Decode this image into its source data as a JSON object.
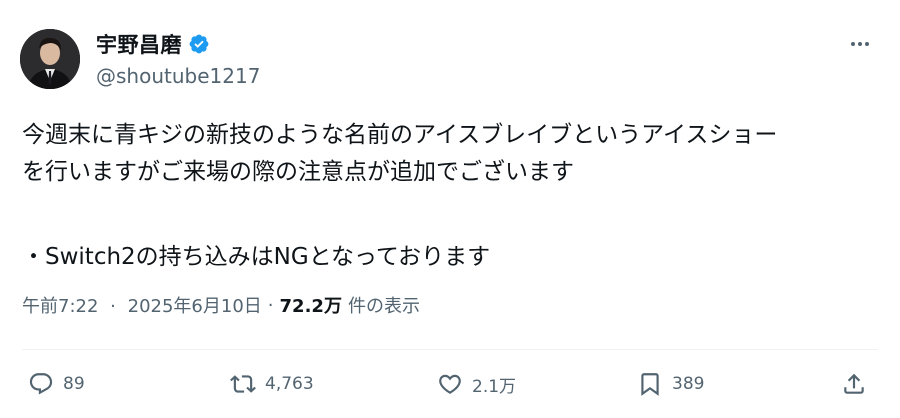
{
  "author": {
    "display_name": "宇野昌磨",
    "handle": "@shoutube1217",
    "verified": true,
    "avatar_icon": "profile-avatar-icon"
  },
  "tweet": {
    "lines": [
      "今週末に青キジの新技のような名前のアイスブレイブというアイスショー",
      "を行いますがご来場の際の注意点が追加でございます",
      "",
      "・Switch2の持ち込みはNGとなっております"
    ]
  },
  "meta": {
    "time": "午前7:22",
    "date": "2025年6月10日",
    "separator": "·",
    "views_count": "72.2万",
    "views_label": "件の表示"
  },
  "actions": {
    "reply": {
      "icon": "reply-icon",
      "count": "89"
    },
    "retweet": {
      "icon": "retweet-icon",
      "count": "4,763"
    },
    "like": {
      "icon": "heart-icon",
      "count": "2.1万"
    },
    "bookmark": {
      "icon": "bookmark-icon",
      "count": "389"
    },
    "share": {
      "icon": "share-icon"
    }
  },
  "colors": {
    "text": "#0f1419",
    "secondary": "#536471",
    "verified": "#1d9bf0",
    "divider": "#eff3f4"
  }
}
